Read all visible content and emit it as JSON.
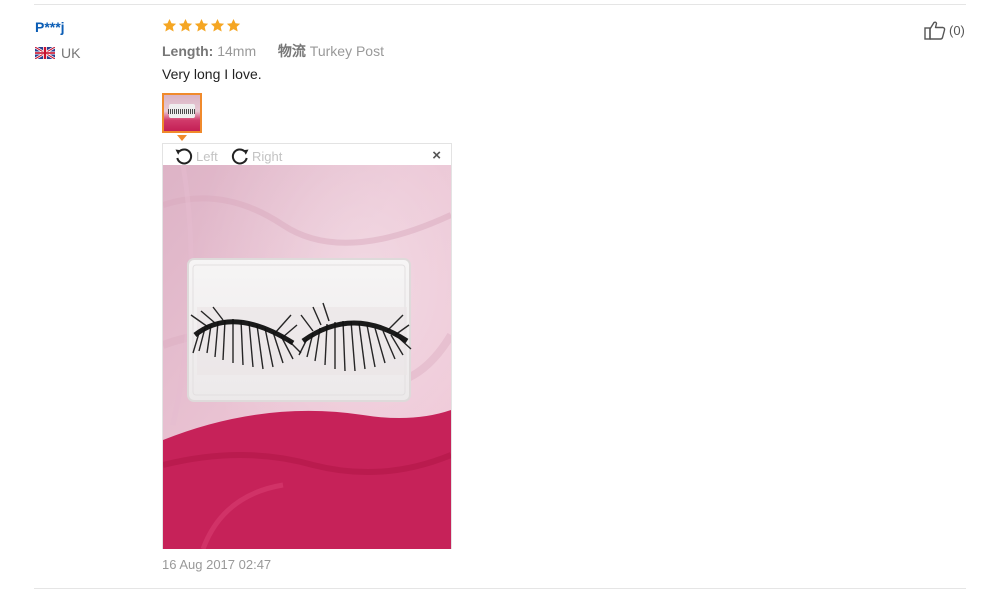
{
  "review": {
    "buyer_name": "P***j",
    "country": "UK",
    "rating": 5,
    "attributes": {
      "length_label": "Length:",
      "length_value": "14mm",
      "logistics_label": "物流",
      "logistics_value": "Turkey Post"
    },
    "text": "Very long I love.",
    "timestamp": "16 Aug 2017 02:47",
    "helpful_count": "(0)"
  },
  "viewer": {
    "rotate_left_label": "Left",
    "rotate_right_label": "Right",
    "close_symbol": "×"
  },
  "icons": {
    "flag": "uk-flag-icon",
    "star": "star-icon",
    "rotate_left": "rotate-left-icon",
    "rotate_right": "rotate-right-icon",
    "close": "close-icon",
    "thumbs_up": "thumbs-up-icon"
  },
  "colors": {
    "star": "#f5a623",
    "buyer_link": "#0b5db5",
    "thumb_border": "#f08a2c",
    "pink_fabric": "#e9b8cc",
    "magenta_fabric": "#c41f55"
  }
}
